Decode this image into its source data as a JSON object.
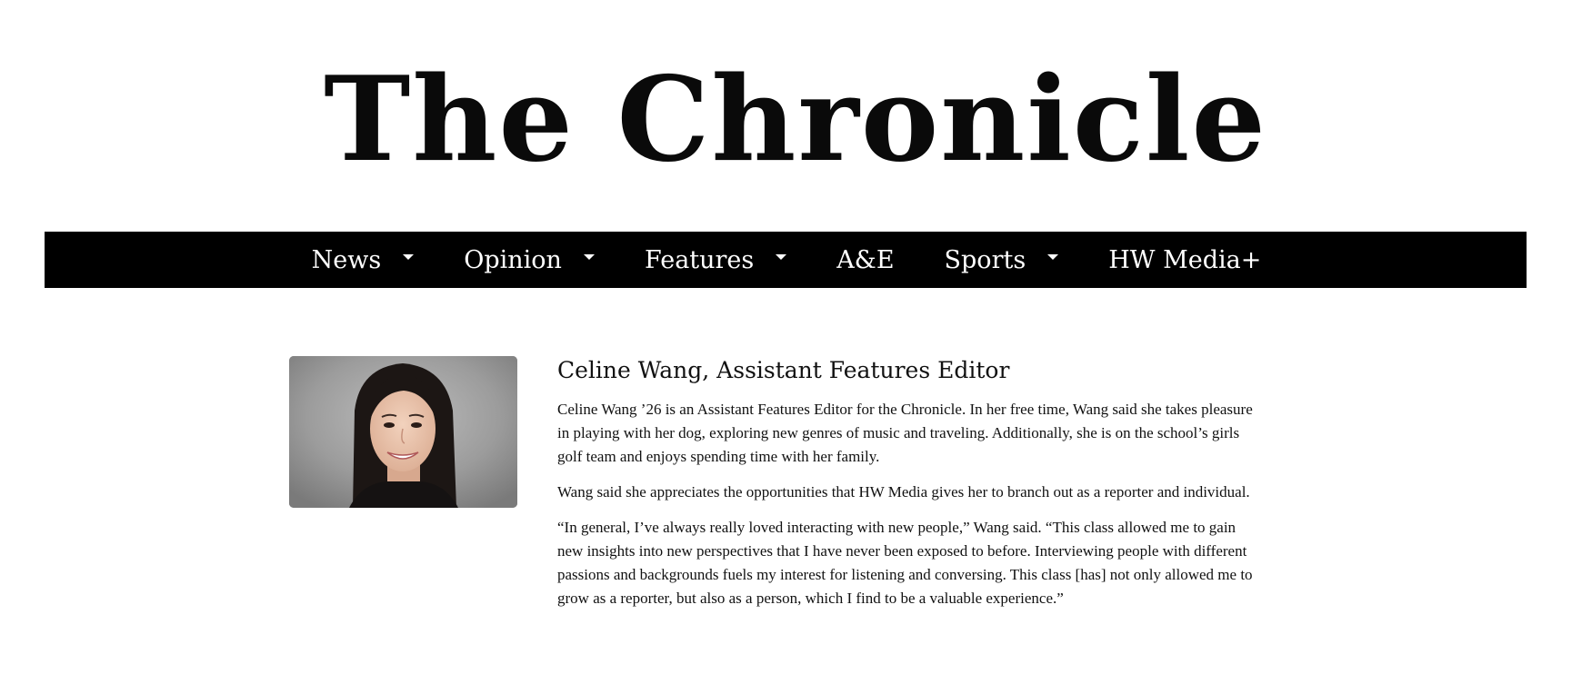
{
  "masthead": {
    "title": "The Chronicle"
  },
  "nav": {
    "items": [
      {
        "label": "News",
        "has_dropdown": true
      },
      {
        "label": "Opinion",
        "has_dropdown": true
      },
      {
        "label": "Features",
        "has_dropdown": true
      },
      {
        "label": "A&E",
        "has_dropdown": false
      },
      {
        "label": "Sports",
        "has_dropdown": true
      },
      {
        "label": "HW Media+",
        "has_dropdown": false
      }
    ],
    "dropdown_icon": "caret-down-icon"
  },
  "profile": {
    "photo_alt": "Celine Wang",
    "name": "Celine Wang, Assistant Features Editor",
    "paragraphs": [
      "Celine Wang ’26 is an Assistant Features Editor for the Chronicle. In her free time, Wang said she takes pleasure in playing with her dog, exploring new genres of music and traveling. Additionally, she is on the school’s girls golf team and enjoys spending time with her family.",
      "Wang said she appreciates the opportunities that HW Media gives her to branch out as a reporter and individual.",
      "“In general, I’ve always really loved interacting with new people,” Wang said. “This class allowed me to gain new insights into new perspectives that I have never been exposed to before. Interviewing people with different passions and backgrounds fuels my interest for listening and conversing. This class [has] not only allowed me to grow as a reporter, but also as a person, which I find to be a valuable experience.”"
    ]
  },
  "colors": {
    "nav_background": "#000000",
    "nav_text": "#ffffff",
    "body_text": "#111111"
  }
}
